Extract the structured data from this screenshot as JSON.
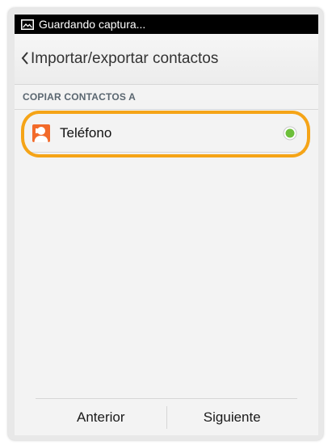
{
  "status_bar": {
    "notification_text": "Guardando captura...",
    "icon": "screenshot-icon"
  },
  "action_bar": {
    "back_icon": "chevron-left-icon",
    "title": "Importar/exportar contactos"
  },
  "section": {
    "header": "COPIAR CONTACTOS A"
  },
  "options": [
    {
      "label": "Teléfono",
      "icon": "phone-contact-icon",
      "selected": true
    }
  ],
  "footer": {
    "previous_label": "Anterior",
    "next_label": "Siguiente"
  },
  "colors": {
    "highlight": "#f5a417",
    "radio_selected": "#6dbf3a",
    "contact_icon": "#f26a2a"
  }
}
